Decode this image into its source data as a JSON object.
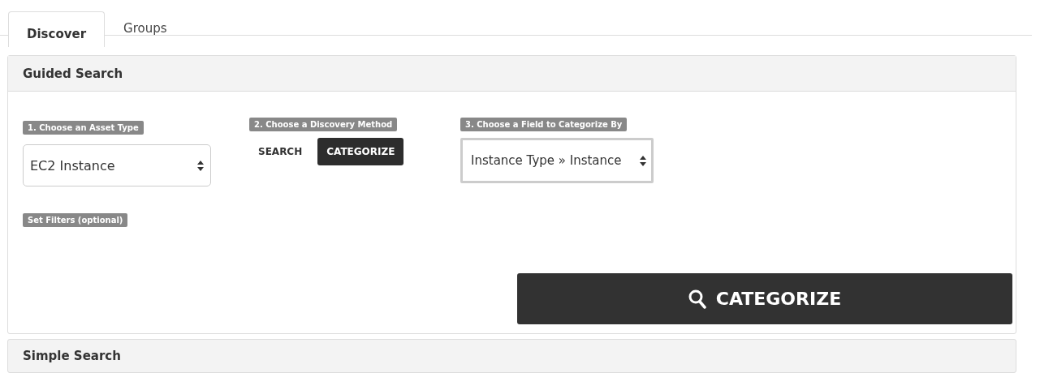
{
  "tabs": [
    {
      "label": "Discover",
      "selected": true
    },
    {
      "label": "Groups",
      "selected": false
    }
  ],
  "guided_search": {
    "title": "Guided Search",
    "asset_type": {
      "label": "1. Choose an Asset Type",
      "value": "EC2 Instance"
    },
    "discovery_method": {
      "label": "2. Choose a Discovery Method",
      "options": [
        {
          "label": "SEARCH",
          "selected": false
        },
        {
          "label": "CATEGORIZE",
          "selected": true
        }
      ]
    },
    "categorize_field": {
      "label": "3. Choose a Field to Categorize By",
      "value": "Instance Type » Instance"
    },
    "filters": {
      "label": "Set Filters (optional)"
    },
    "submit_button": "CATEGORIZE"
  },
  "simple_search": {
    "title": "Simple Search"
  }
}
